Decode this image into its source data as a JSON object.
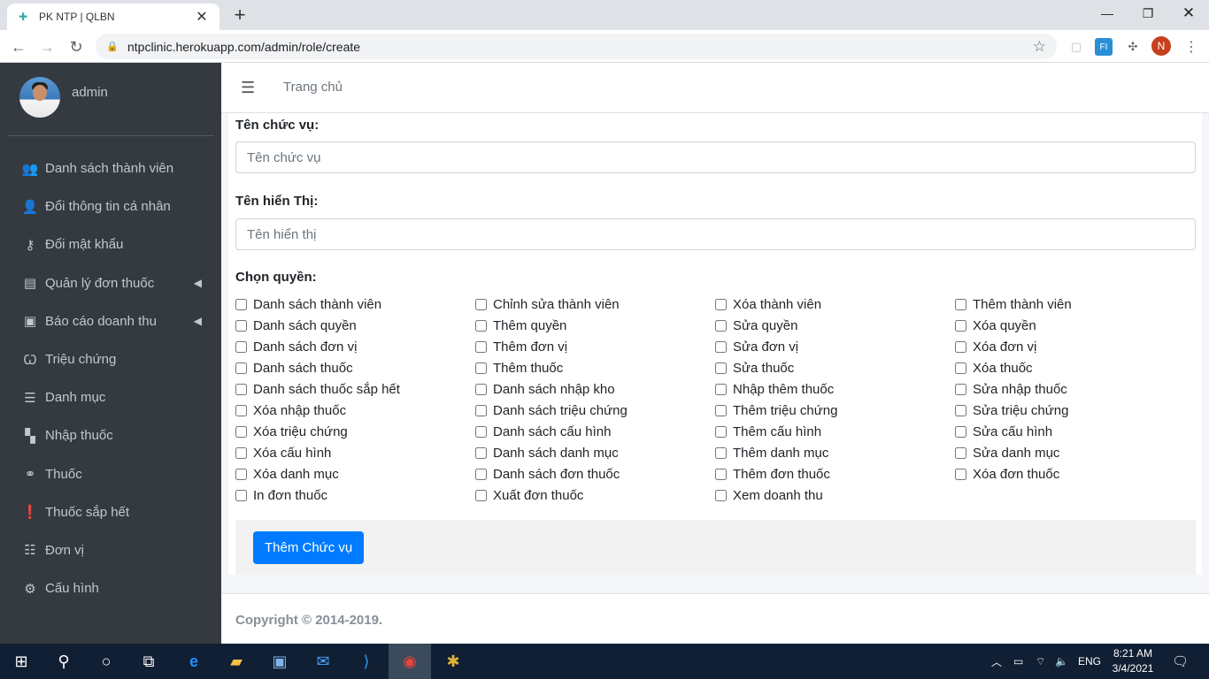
{
  "browser": {
    "tab_title": "PK NTP | QLBN",
    "url": "ntpclinic.herokuapp.com/admin/role/create",
    "profile_initial": "N",
    "icons": [
      "back-icon",
      "forward-icon",
      "reload-icon",
      "lock-icon",
      "star-icon",
      "extensions-icon"
    ]
  },
  "sidebar": {
    "user_name": "admin",
    "items": [
      {
        "label": "Danh sách thành viên",
        "icon": "users-icon"
      },
      {
        "label": "Đổi thông tin cá nhân",
        "icon": "user-edit-icon"
      },
      {
        "label": "Đổi mật khẩu",
        "icon": "key-icon"
      },
      {
        "label": "Quản lý đơn thuốc",
        "icon": "file-icon"
      },
      {
        "label": "Báo cáo doanh thu",
        "icon": "money-icon"
      },
      {
        "label": "Triệu chứng",
        "icon": "stethoscope-icon"
      },
      {
        "label": "Danh mục",
        "icon": "list-icon"
      },
      {
        "label": "Nhập thuốc",
        "icon": "boxes-icon"
      },
      {
        "label": "Thuốc",
        "icon": "binoculars-icon"
      },
      {
        "label": "Thuốc sắp hết",
        "icon": "exclamation-icon"
      },
      {
        "label": "Đơn vị",
        "icon": "list-alt-icon"
      },
      {
        "label": "Cấu hình",
        "icon": "user-cog-icon"
      }
    ]
  },
  "topnav": {
    "home_label": "Trang chủ"
  },
  "form": {
    "role_name_label": "Tên chức vụ:",
    "role_name_placeholder": "Tên chức vụ",
    "display_name_label": "Tên hiển Thị:",
    "display_name_placeholder": "Tên hiển thị",
    "permissions_label": "Chọn quyền:",
    "permissions": [
      "Danh sách thành viên",
      "Chỉnh sửa thành viên",
      "Xóa thành viên",
      "Thêm thành viên",
      "Danh sách quyền",
      "Thêm quyền",
      "Sửa quyền",
      "Xóa quyền",
      "Danh sách đơn vị",
      "Thêm đơn vị",
      "Sửa đơn vị",
      "Xóa đơn vị",
      "Danh sách thuốc",
      "Thêm thuốc",
      "Sửa thuốc",
      "Xóa thuốc",
      "Danh sách thuốc sắp hết",
      "Danh sách nhập kho",
      "Nhập thêm thuốc",
      "Sửa nhập thuốc",
      "Xóa nhập thuốc",
      "Danh sách triệu chứng",
      "Thêm triệu chứng",
      "Sửa triệu chứng",
      "Xóa triệu chứng",
      "Danh sách cấu hình",
      "Thêm cấu hình",
      "Sửa cấu hình",
      "Xóa cấu hình",
      "Danh sách danh mục",
      "Thêm danh mục",
      "Sửa danh mục",
      "Xóa danh mục",
      "Danh sách đơn thuốc",
      "Thêm đơn thuốc",
      "Xóa đơn thuốc",
      "In đơn thuốc",
      "Xuất đơn thuốc",
      "Xem doanh thu"
    ],
    "submit_label": "Thêm Chức vụ"
  },
  "footer": {
    "copyright": "Copyright © 2014-2019."
  },
  "taskbar": {
    "language": "ENG",
    "time": "8:21 AM",
    "date": "3/4/2021"
  },
  "colors": {
    "sidebar_bg": "#343a40",
    "primary": "#007bff",
    "taskbar_bg": "#101f33"
  }
}
